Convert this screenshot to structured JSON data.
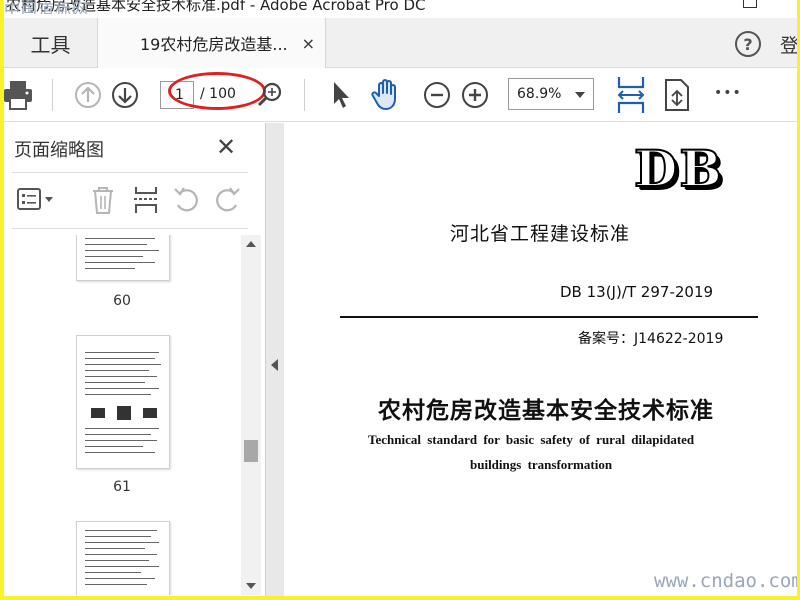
{
  "window": {
    "title": "农村危房改造基本安全技术标准.pdf - Adobe Acrobat Pro DC",
    "watermark_top": "中国道标网"
  },
  "tabs": {
    "tools_label": "工具",
    "doc_tab_label": "19农村危房改造基...",
    "close_glyph": "×",
    "help_glyph": "?",
    "signin_label": "登"
  },
  "toolbar": {
    "current_page": "1",
    "total_pages": "/ 100",
    "zoom_value": "68.9%",
    "more_glyph": "•••"
  },
  "panel": {
    "title": "页面缩略图",
    "close_glyph": "✕",
    "thumbnails": [
      {
        "label": "60"
      },
      {
        "label": "61"
      },
      {
        "label": ""
      }
    ]
  },
  "document": {
    "logo": "DB",
    "organization": "河北省工程建设标准",
    "code": "DB 13(J)/T 297-2019",
    "record_no": "备案号：J14622-2019",
    "title_cn": "农村危房改造基本安全技术标准",
    "title_en_line1": "Technical standard for basic safety of rural dilapidated",
    "title_en_line2": "buildings transformation"
  },
  "watermark_bottom": "www.cndao.com",
  "colors": {
    "annotation_red": "#e02020",
    "page_border_yellow": "#f8f22a",
    "icon_blue": "#1f5fb0"
  }
}
